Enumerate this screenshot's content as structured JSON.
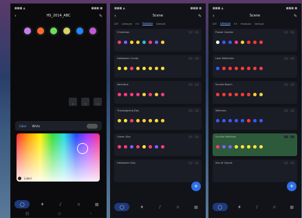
{
  "phone1": {
    "title": "HS_2014_ABC",
    "bulb_colors": [
      "#c97cf0",
      "#ff6a2a",
      "#6adf5a",
      "#d9d36a",
      "#1e88ff",
      "#c059d8"
    ],
    "toggle_label": "White",
    "toggle_prefix": "Color",
    "swatch_label": "Label"
  },
  "phone2": {
    "title": "Scene",
    "tabs": [
      "DIY",
      "Lifestyle",
      "FX",
      "Festivals",
      "Default"
    ],
    "active_tab": 3,
    "scenes": [
      {
        "name": "Christmas",
        "dots": [
          "#ff3b7a",
          "#7b61ff",
          "#ffd23a",
          "#ffd23a",
          "#2bc0e4",
          "#ff3b7a",
          "#7b61ff",
          "#ffd23a"
        ]
      },
      {
        "name": "Halloween Candy",
        "dots": [
          "#ffe63a",
          "#ffe63a",
          "#ff3b7a",
          "#ffd23a",
          "#ffe63a",
          "#ffd23a",
          "#ffd23a",
          "#ffe63a"
        ]
      },
      {
        "name": "Valentine",
        "dots": [
          "#ff3b7a",
          "#ff3b7a",
          "#ff3b7a",
          "#ff3b7a",
          "#ffd23a",
          "#ff3b7a",
          "#ffd23a",
          "#ff3b7a"
        ]
      },
      {
        "name": "Thanksgiving Day",
        "dots": [
          "#ffd23a",
          "#ffe63a",
          "#ff3b7a",
          "#ffd23a",
          "#ffd23a",
          "#ffd23a",
          "#ffe63a",
          "#ffd23a"
        ]
      },
      {
        "name": "Ocean Day",
        "dots": [
          "#ff3b7a",
          "#ff3b7a",
          "#7b61ff",
          "#ff3b7a",
          "#ffe63a",
          "#ff3b7a",
          "#7b61ff",
          "#ff3b7a"
        ]
      },
      {
        "name": "Halloween Day",
        "dots": []
      }
    ]
  },
  "phone3": {
    "title": "Scene",
    "tabs": [
      "DIY",
      "Lifestyle",
      "FX",
      "Festivals",
      "Default"
    ],
    "active_tab": 1,
    "scenes": [
      {
        "name": "Flower Garden",
        "dots": [
          "#ffffff",
          "#3a5bff",
          "#3a5bff",
          "#ff3b7a",
          "#ffd23a",
          "#ff3b3b",
          "#ff3b3b",
          "#ff3b3b"
        ]
      },
      {
        "name": "Lake Reflection",
        "dots": [
          "#3a5bff",
          "#ff3b3b",
          "#ff3b3b",
          "#ff3b3b",
          "#ff3b3b",
          "#ff3b3b",
          "#ff3b3b",
          "#ff3b3b"
        ]
      },
      {
        "name": "Sunset Beach",
        "dots": [
          "#ff3b3b",
          "#ff3b3b",
          "#ff3b3b",
          "#ff3b3b",
          "#ff3b3b",
          "#ff3b3b",
          "#ffd23a",
          "#ffd23a"
        ]
      },
      {
        "name": "Wellness",
        "dots": [
          "#3a5bff",
          "#3a5bff",
          "#3a5bff",
          "#3a5bff",
          "#3a5bff",
          "#ff3b3b",
          "#3a5bff",
          "#3a5bff"
        ]
      },
      {
        "name": "Sunrise Rainbow",
        "dots": [
          "#ff3b7a",
          "#7b61ff",
          "#7b61ff",
          "#ffe63a",
          "#ffe63a",
          "#ffe63a",
          "#ffe63a",
          "#ffe63a"
        ]
      },
      {
        "name": "Sea of Clouds",
        "dots": []
      }
    ]
  }
}
